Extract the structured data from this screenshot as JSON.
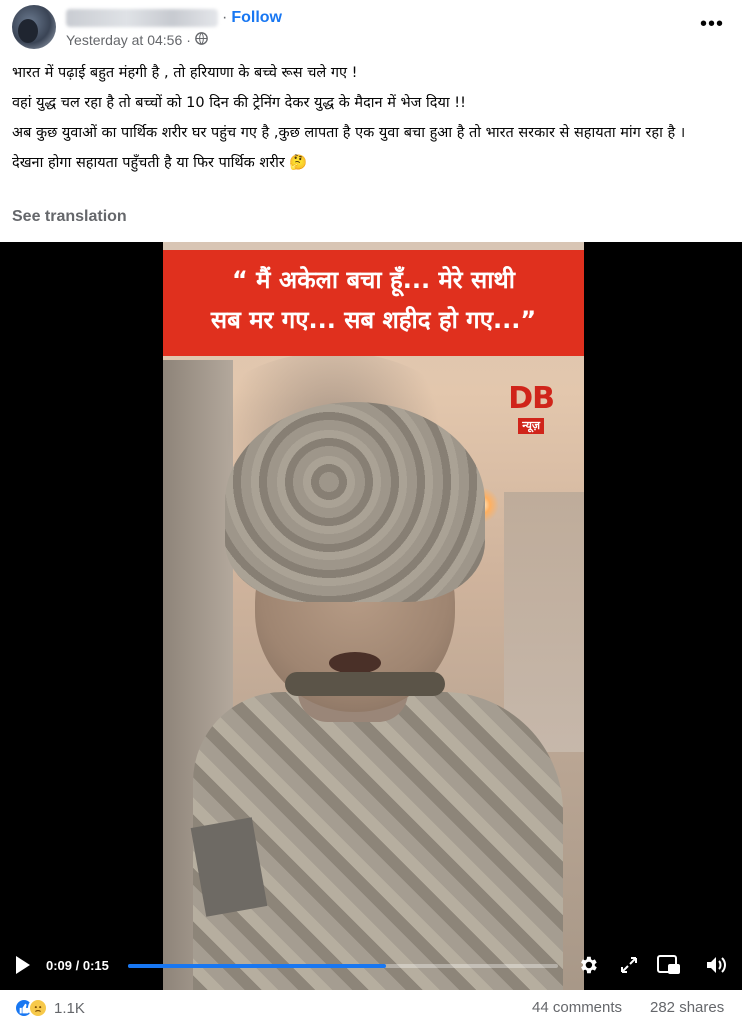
{
  "header": {
    "follow_label": "Follow",
    "dot": "·",
    "timestamp": "Yesterday at 04:56",
    "separator": "·",
    "more_label": "•••"
  },
  "post": {
    "lines": [
      "भारत में पढ़ाई बहुत मंहगी है , तो हरियाणा के बच्चे रूस चले गए !",
      "वहां युद्ध चल रहा है तो बच्चों को 10 दिन की  ट्रेनिंग देकर युद्ध के मैदान में भेज दिया !!",
      "अब कुछ युवाओं का पार्थिक शरीर घर पहुंच गए है ,कुछ लापता है एक युवा बचा हुआ है तो भारत सरकार से सहायता मांग रहा है ।",
      "देखना होगा सहायता पहुँचती है या फिर पार्थिक शरीर 🤔"
    ],
    "see_translation": "See translation"
  },
  "video": {
    "banner_line1": "“ मैं अकेला बचा हूँ... मेरे साथी",
    "banner_line2": "सब मर गए... सब शहीद हो गए...”",
    "logo_main": "DB",
    "logo_sub": "न्यूज़",
    "current_time": "0:09",
    "time_separator": " / ",
    "duration": "0:15",
    "progress_fraction": 0.6
  },
  "footer": {
    "reaction_count": "1.1K",
    "comments": "44 comments",
    "shares": "282 shares"
  },
  "icons": {
    "like": "like-reaction-icon",
    "sad": "sad-reaction-icon",
    "globe": "globe-icon",
    "play": "play-icon",
    "settings": "gear-icon",
    "fullscreen": "expand-icon",
    "pip": "picture-in-picture-icon",
    "volume": "volume-icon"
  },
  "colors": {
    "accent": "#1877f2",
    "banner": "#e0301e",
    "logo": "#d0241a"
  }
}
